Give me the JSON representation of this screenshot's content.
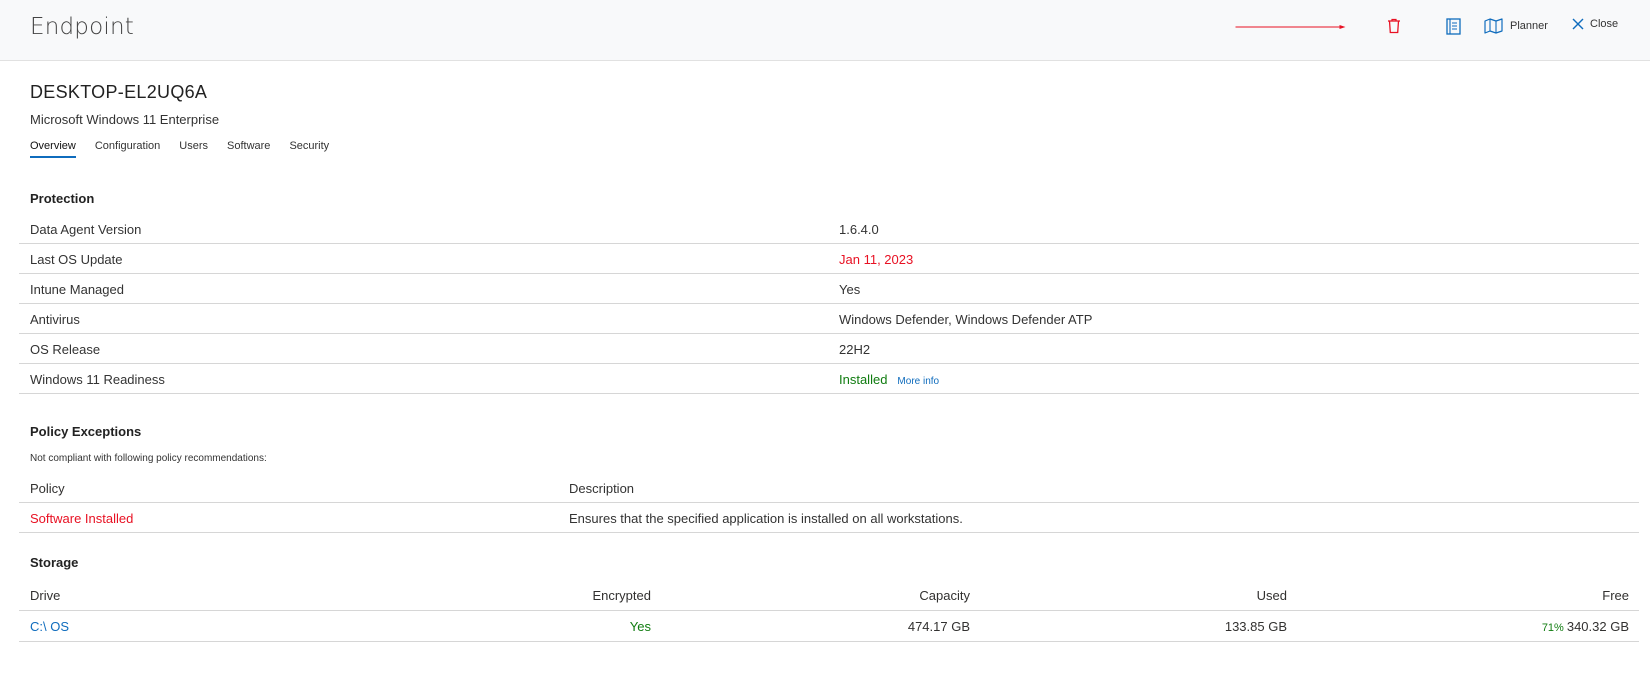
{
  "topbar": {
    "title": "Endpoint",
    "planner_label": "Planner",
    "close_label": "Close"
  },
  "device": {
    "name": "DESKTOP-EL2UQ6A",
    "os": "Microsoft Windows 11 Enterprise"
  },
  "tabs": [
    {
      "label": "Overview"
    },
    {
      "label": "Configuration"
    },
    {
      "label": "Users"
    },
    {
      "label": "Software"
    },
    {
      "label": "Security"
    }
  ],
  "protection": {
    "title": "Protection",
    "rows": [
      {
        "label": "Data Agent Version",
        "value": "1.6.4.0"
      },
      {
        "label": "Last OS Update",
        "value": "Jan 11, 2023"
      },
      {
        "label": "Intune Managed",
        "value": "Yes"
      },
      {
        "label": "Antivirus",
        "value": "Windows Defender, Windows Defender ATP"
      },
      {
        "label": "OS Release",
        "value": "22H2"
      },
      {
        "label": "Windows 11 Readiness",
        "value": "Installed",
        "link": "More info"
      }
    ]
  },
  "policy": {
    "title": "Policy Exceptions",
    "note": "Not compliant with following policy recommendations:",
    "headers": [
      "Policy",
      "Description"
    ],
    "rows": [
      {
        "policy": "Software Installed",
        "description": "Ensures that the specified application is installed on all workstations."
      }
    ]
  },
  "storage": {
    "title": "Storage",
    "headers": [
      "Drive",
      "Encrypted",
      "Capacity",
      "Used",
      "Free"
    ],
    "rows": [
      {
        "drive": "C:\\ OS",
        "encrypted": "Yes",
        "capacity": "474.17 GB",
        "used": "133.85 GB",
        "free_pct": "71%",
        "free": "340.32 GB"
      }
    ]
  },
  "colors": {
    "accent": "#0f6cbd",
    "danger": "#e81123",
    "success": "#107c10"
  }
}
